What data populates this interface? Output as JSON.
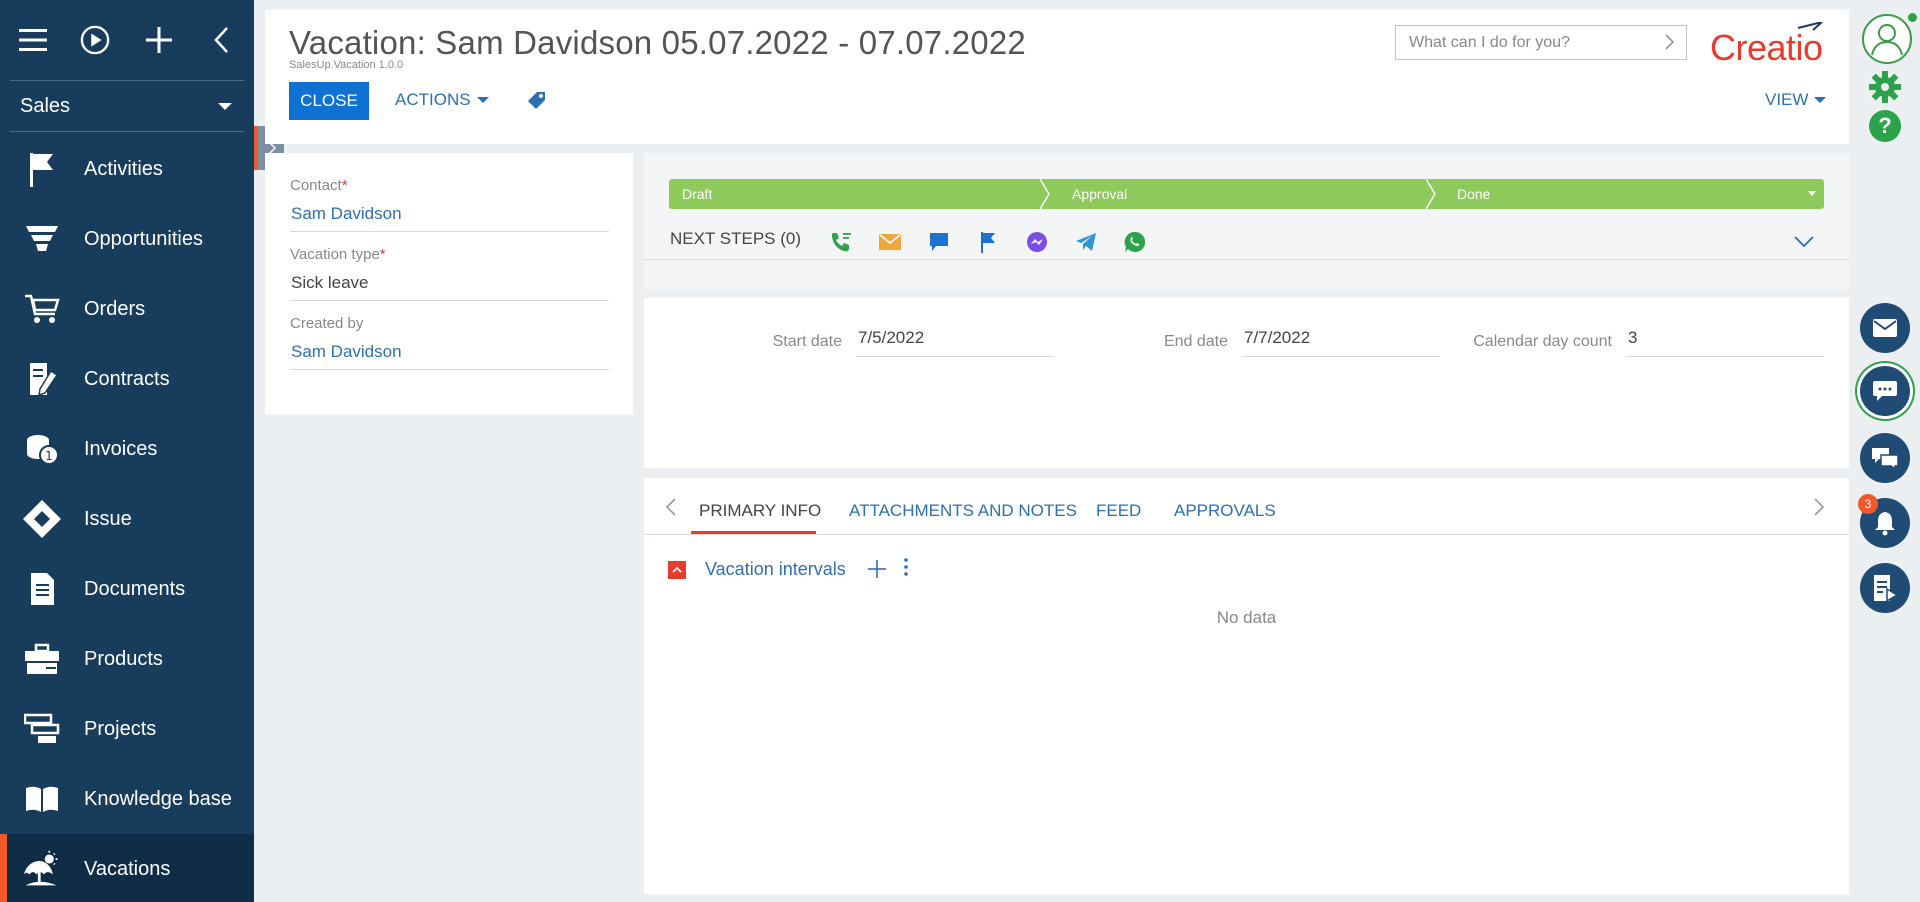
{
  "sidebar": {
    "workspace": "Sales",
    "items": [
      {
        "label": "Activities",
        "icon": "flag-icon"
      },
      {
        "label": "Opportunities",
        "icon": "funnel-icon"
      },
      {
        "label": "Orders",
        "icon": "cart-icon"
      },
      {
        "label": "Contracts",
        "icon": "contract-icon"
      },
      {
        "label": "Invoices",
        "icon": "coins-icon"
      },
      {
        "label": "Issue",
        "icon": "diamond-icon"
      },
      {
        "label": "Documents",
        "icon": "document-icon"
      },
      {
        "label": "Products",
        "icon": "briefcase-icon"
      },
      {
        "label": "Projects",
        "icon": "projects-icon"
      },
      {
        "label": "Knowledge base",
        "icon": "book-icon"
      },
      {
        "label": "Vacations",
        "icon": "beach-umbrella-icon"
      }
    ],
    "active": "Vacations"
  },
  "header": {
    "title": "Vacation: Sam Davidson 05.07.2022 - 07.07.2022",
    "subtitle": "SalesUp.Vacation 1.0.0",
    "close_label": "CLOSE",
    "actions_label": "ACTIONS",
    "view_label": "VIEW",
    "search_placeholder": "What can I do for you?",
    "logo_text": "Creatio"
  },
  "info": {
    "contact_label": "Contact",
    "contact_value": "Sam Davidson",
    "type_label": "Vacation type",
    "type_value": "Sick leave",
    "created_label": "Created by",
    "created_value": "Sam Davidson",
    "required_mark": "*"
  },
  "stages": {
    "items": [
      "Draft",
      "Approval",
      "Done"
    ],
    "next_steps_label": "NEXT STEPS (0)"
  },
  "dates": {
    "start_label": "Start date",
    "start_value": "7/5/2022",
    "end_label": "End date",
    "end_value": "7/7/2022",
    "count_label": "Calendar day count",
    "count_value": "3"
  },
  "tabs": {
    "items": [
      "PRIMARY INFO",
      "ATTACHMENTS AND NOTES",
      "FEED",
      "APPROVALS"
    ],
    "active": "PRIMARY INFO",
    "detail_title": "Vacation intervals",
    "no_data": "No data"
  },
  "rail": {
    "notification_count": "3"
  },
  "colors": {
    "sidebar": "#173c5c",
    "accent": "#f05a28",
    "primary": "#0d72d2",
    "link": "#2d6fb4",
    "stage": "#8ec95c",
    "green": "#2ca24a"
  }
}
